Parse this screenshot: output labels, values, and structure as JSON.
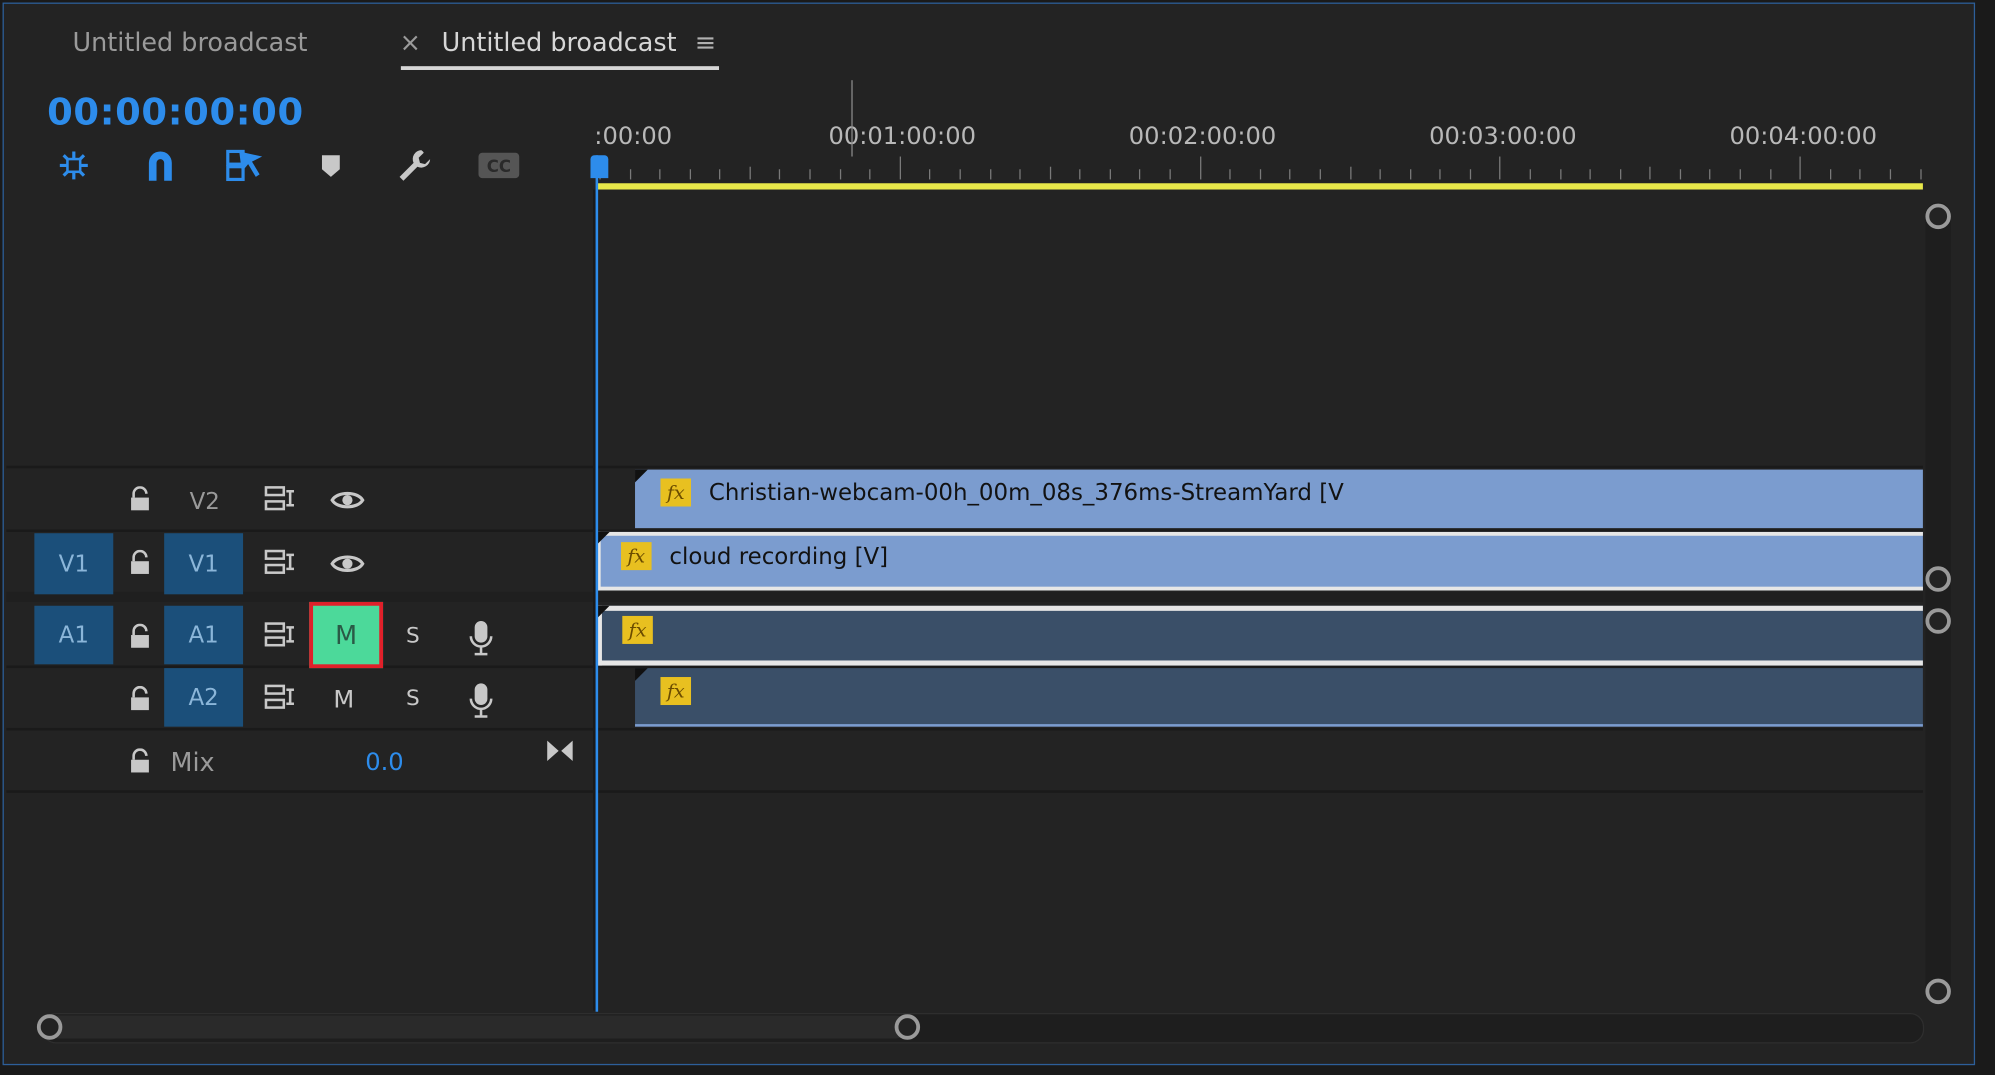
{
  "tabs": [
    {
      "label": "Untitled broadcast",
      "active": false
    },
    {
      "label": "Untitled broadcast",
      "active": true
    }
  ],
  "tab_close": "×",
  "tab_menu": "≡",
  "timecode": "00:00:00:00",
  "ruler": {
    "labels": [
      ":00:00",
      "00:01:00:00",
      "00:02:00:00",
      "00:03:00:00",
      "00:04:00:00"
    ]
  },
  "tracks": {
    "v2": {
      "label": "V2"
    },
    "v1": {
      "source": "V1",
      "label": "V1"
    },
    "a1": {
      "source": "A1",
      "label": "A1",
      "mute": "M",
      "solo": "S"
    },
    "a2": {
      "label": "A2",
      "mute": "M",
      "solo": "S"
    },
    "mix": {
      "label": "Mix",
      "value": "0.0"
    }
  },
  "clips": {
    "v2_title": "Christian-webcam-00h_00m_08s_376ms-StreamYard [V",
    "v1_title": "cloud recording [V]",
    "fx": "fx"
  },
  "colors": {
    "accent": "#2d8ceb",
    "video_clip": "#7b9ccf",
    "audio_clip": "#3a4f68",
    "mute_active": "#4cd99a",
    "highlight": "#e0202a",
    "work_area": "#e8e84a"
  }
}
